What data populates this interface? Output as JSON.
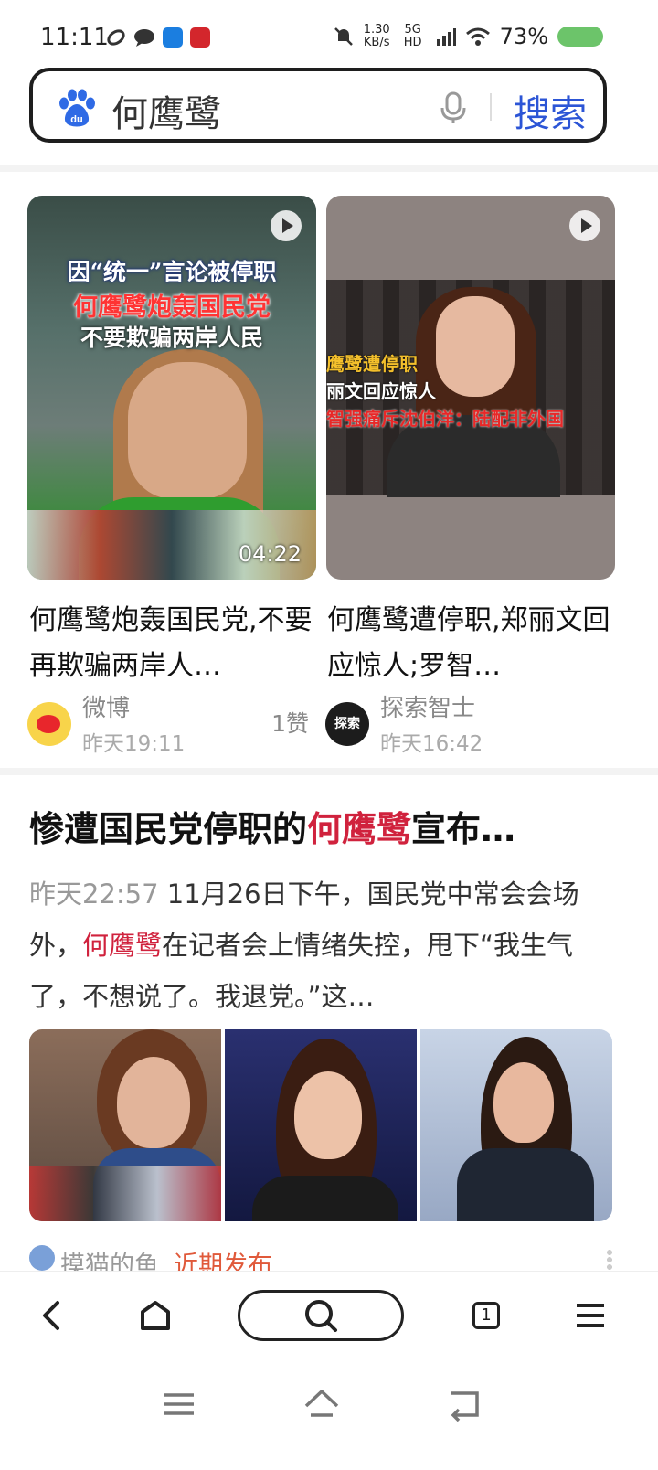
{
  "status_bar": {
    "time": "11:11",
    "net_speed_value": "1.30",
    "net_speed_unit": "KB/s",
    "signal_label": "5G HD",
    "battery": "73%",
    "app_icons": [
      "link-icon",
      "chat-icon",
      "app-blue-icon",
      "app-red-icon"
    ],
    "battery_color": "#6cc46a"
  },
  "search": {
    "query": "何鹰鹭",
    "button_label": "搜索",
    "accent_color": "#2c55d6"
  },
  "video_cards": [
    {
      "overlay_lines": [
        "因“统一”言论被停职",
        "何鹰鹭炮轰国民党",
        "不要欺骗两岸人民"
      ],
      "duration": "04:22",
      "title": "何鹰鹭炮轰国民党,不要再欺骗两岸人…",
      "source": "微博",
      "time": "昨天19:11",
      "likes": "1赞"
    },
    {
      "overlay_lines": [
        "鹰鹭遭停职",
        "丽文回应惊人",
        "智强痛斥沈伯洋：陆配非外国"
      ],
      "title": "何鹰鹭遭停职,郑丽文回应惊人;罗智…",
      "source": "探索智士",
      "time": "昨天16:42",
      "avatar_text": "探索"
    }
  ],
  "article": {
    "title_prefix": "惨遭国民党停职的",
    "title_highlight": "何鹰鹭",
    "title_suffix": "宣布…",
    "time": "昨天22:57",
    "body_part1": " 11月26日下午，国民党中常会会场外，",
    "body_highlight": "何鹰鹭",
    "body_part2": "在记者会上情绪失控，甩下“我生气了，不想说了。我退党。”这…",
    "source": "摸猫的鱼",
    "recent_tag": "近期发布",
    "highlight_color": "#d0223d"
  },
  "toolbar": {
    "tab_count": "1"
  }
}
